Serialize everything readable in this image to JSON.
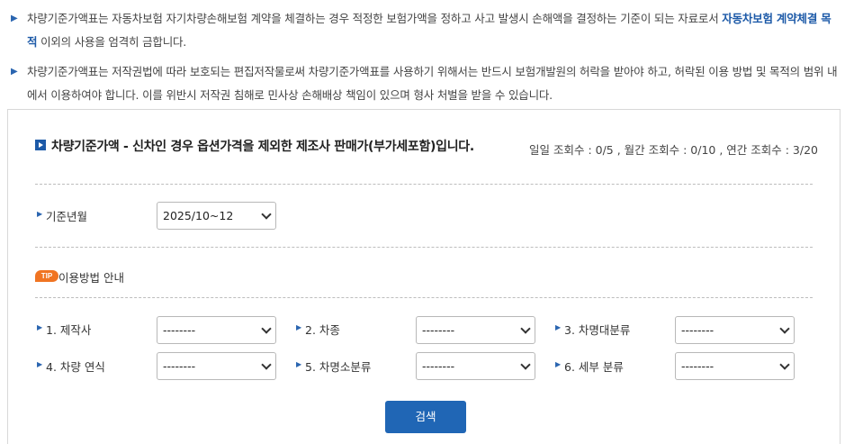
{
  "notice": {
    "item1_part1": "차량기준가액표는 자동차보험 자기차량손해보험 계약을 체결하는 경우 적정한 보험가액을 정하고 사고 발생시 손해액을 결정하는 기준이 되는 자료로서 ",
    "item1_highlight": "자동차보험 계약체결 목적",
    "item1_part2": " 이외의 사용을 엄격히 금합니다.",
    "item2": "차량기준가액표는 저작권법에 따라 보호되는 편집저작물로써 차량기준가액표를 사용하기 위해서는 반드시 보험개발원의 허락을 받아야 하고, 허락된 이용 방법 및 목적의 범위 내에서 이용하여야 합니다. 이를 위반시 저작권 침해로 민사상 손해배상 책임이 있으며 형사 처벌을 받을 수 있습니다."
  },
  "header": {
    "title": "차량기준가액 - 신차인 경우 옵션가격을 제외한 제조사 판매가(부가세포함)입니다.",
    "stats": "일일 조회수 : 0/5 , 월간 조회수 : 0/10 , 연간 조회수 : 3/20"
  },
  "base_period": {
    "label": "기준년월",
    "value": "2025/10~12"
  },
  "tip": {
    "badge": "TIP",
    "label": "이용방법 안내"
  },
  "filters": [
    {
      "label": "1. 제작사",
      "value": "--------"
    },
    {
      "label": "2. 차종",
      "value": "--------"
    },
    {
      "label": "3. 차명대분류",
      "value": "--------"
    },
    {
      "label": "4. 차량 연식",
      "value": "--------"
    },
    {
      "label": "5. 차명소분류",
      "value": "--------"
    },
    {
      "label": "6. 세부 분류",
      "value": "--------"
    }
  ],
  "search_button": "검색"
}
